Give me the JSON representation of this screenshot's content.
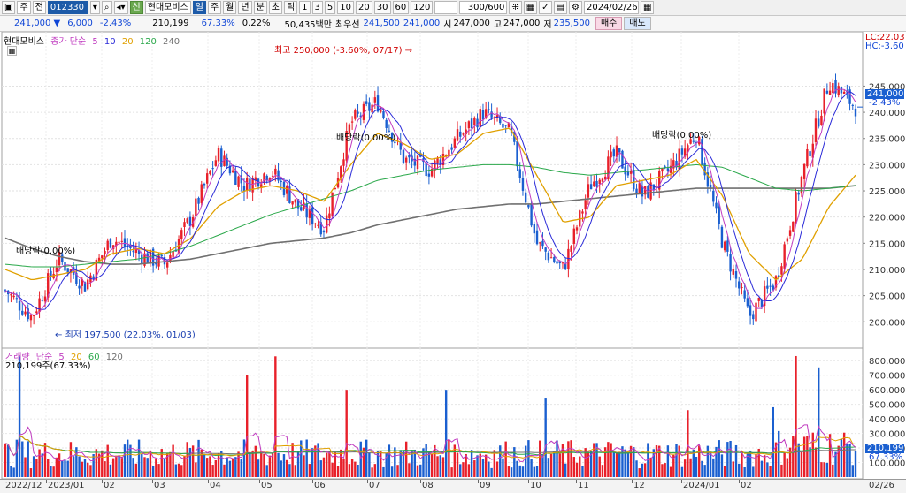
{
  "toolbar": {
    "market_select": "주",
    "period_select": "전",
    "code_value": "012330",
    "stock_badge": "신",
    "stock_name": "현대모비스",
    "period_buttons": [
      "일",
      "주",
      "월",
      "년",
      "분",
      "초",
      "틱"
    ],
    "interval_buttons": [
      "1",
      "3",
      "5",
      "10",
      "20",
      "30",
      "60",
      "120"
    ],
    "count_value": "300",
    "count_total": "/600",
    "date_value": "2024/02/26",
    "search_icon": "search-icon",
    "settings_icon": "gear-icon",
    "calendar_icon": "calendar-icon"
  },
  "quote": {
    "price": "241,000",
    "change": "6,000",
    "change_pct": "-2.43%",
    "volume": "210,199",
    "volume_pct": "67.33%",
    "turnover_pct": "0.22%",
    "amount": "50,435백만",
    "best_bid_label": "최우선",
    "ask": "241,500",
    "bid": "241,000",
    "ohlc_open_label": "시",
    "open": "247,000",
    "ohlc_high_label": "고",
    "high": "247,000",
    "ohlc_low_label": "저",
    "low": "235,500",
    "buy_button": "매수",
    "sell_button": "매도"
  },
  "price_panel": {
    "legend_name": "현대모비스",
    "legend_ma_label": "종가 단순",
    "ma_periods": [
      "5",
      "10",
      "20",
      "120",
      "240"
    ],
    "lc_label": "LC:22.03",
    "hc_label": "HC:-3.60",
    "current_price_label": "241,000",
    "current_change_label": "-2.43%",
    "annotations": {
      "high": "최고 250,000 (-3.60%, 07/17)",
      "low": "최저 197,500 (22.03%, 01/03)",
      "dividend_1": "배당락(0.00%)",
      "dividend_2": "배당락(0.00%)",
      "dividend_3": "배당락(0.00%)"
    }
  },
  "volume_panel": {
    "legend_name": "거래량",
    "legend_ma_label": "단순",
    "ma_periods": [
      "5",
      "20",
      "60",
      "120"
    ],
    "value_label": "210,199주(67.33%)",
    "current_label": "210,199",
    "current_pct_label": "67.33%"
  },
  "date_axis": {
    "labels": [
      "2022/12",
      "2023/01",
      "02",
      "03",
      "04",
      "05",
      "06",
      "07",
      "08",
      "09",
      "10",
      "11",
      "12",
      "2024/01",
      "02",
      "02/26"
    ]
  },
  "colors": {
    "up": "#e8202a",
    "down": "#1a5fd0",
    "ma5": "#c03cc0",
    "ma10": "#2a2ad8",
    "ma20": "#e0a000",
    "ma120": "#2aa84a",
    "ma240": "#707070"
  },
  "chart_data": [
    {
      "type": "candlestick",
      "title": "현대모비스",
      "y_ticks": [
        200000,
        205000,
        210000,
        215000,
        220000,
        225000,
        230000,
        235000,
        240000,
        245000
      ],
      "y_tick_labels": [
        "200,000",
        "205,000",
        "210,000",
        "215,000",
        "220,000",
        "225,000",
        "230,000",
        "235,000",
        "240,000",
        "245,000"
      ],
      "ylim": [
        196000,
        253000
      ],
      "grid": true,
      "x": [
        "2022/12",
        "2023/01",
        "02",
        "03",
        "04",
        "05",
        "06",
        "07",
        "08",
        "09",
        "10",
        "11",
        "12",
        "2024/01",
        "02"
      ],
      "close_path": [
        206000,
        201000,
        212000,
        207000,
        216000,
        213000,
        211000,
        220000,
        232000,
        226000,
        229000,
        222000,
        218000,
        238000,
        242000,
        231000,
        229000,
        235000,
        240000,
        236000,
        215000,
        210000,
        226000,
        232000,
        224000,
        229000,
        236000,
        215000,
        201000,
        208000,
        228000,
        246000,
        241000
      ],
      "ma20_path": [
        210000,
        208000,
        209000,
        210000,
        213000,
        214000,
        213000,
        216000,
        222000,
        225000,
        226000,
        225000,
        223000,
        230000,
        236000,
        234000,
        231000,
        232000,
        236000,
        237000,
        228000,
        219000,
        220000,
        226000,
        227000,
        228000,
        231000,
        224000,
        213000,
        208000,
        212000,
        222000,
        228000
      ],
      "ma120_path": [
        211000,
        210500,
        210500,
        211000,
        211500,
        212000,
        213000,
        214500,
        216500,
        218500,
        220500,
        222000,
        223500,
        225000,
        227000,
        228000,
        229000,
        229500,
        230000,
        230000,
        229500,
        228500,
        228000,
        228500,
        229000,
        229500,
        230000,
        229500,
        227500,
        225500,
        225000,
        225500,
        226000
      ],
      "ma240_path": [
        216000,
        214000,
        212500,
        211500,
        211000,
        211000,
        211500,
        212000,
        213000,
        214000,
        215000,
        215500,
        216000,
        217000,
        218500,
        219500,
        220500,
        221500,
        222000,
        222500,
        222500,
        223000,
        223500,
        224000,
        224500,
        225000,
        225500,
        225500,
        225500,
        225500,
        225500,
        225500,
        226000
      ]
    },
    {
      "type": "bar",
      "title": "거래량",
      "y_ticks": [
        100000,
        200000,
        300000,
        400000,
        500000,
        600000,
        700000,
        800000
      ],
      "y_tick_labels": [
        "100,000",
        "200,000",
        "300,000",
        "400,000",
        "500,000",
        "600,000",
        "700,000",
        "800,000"
      ],
      "ylim": [
        0,
        850000
      ],
      "spikes": [
        {
          "x": "05",
          "value": 830000
        },
        {
          "x": "04",
          "value": 700000
        },
        {
          "x": "2024/01",
          "value": 640000
        },
        {
          "x": "02",
          "value": 580000
        }
      ]
    }
  ]
}
